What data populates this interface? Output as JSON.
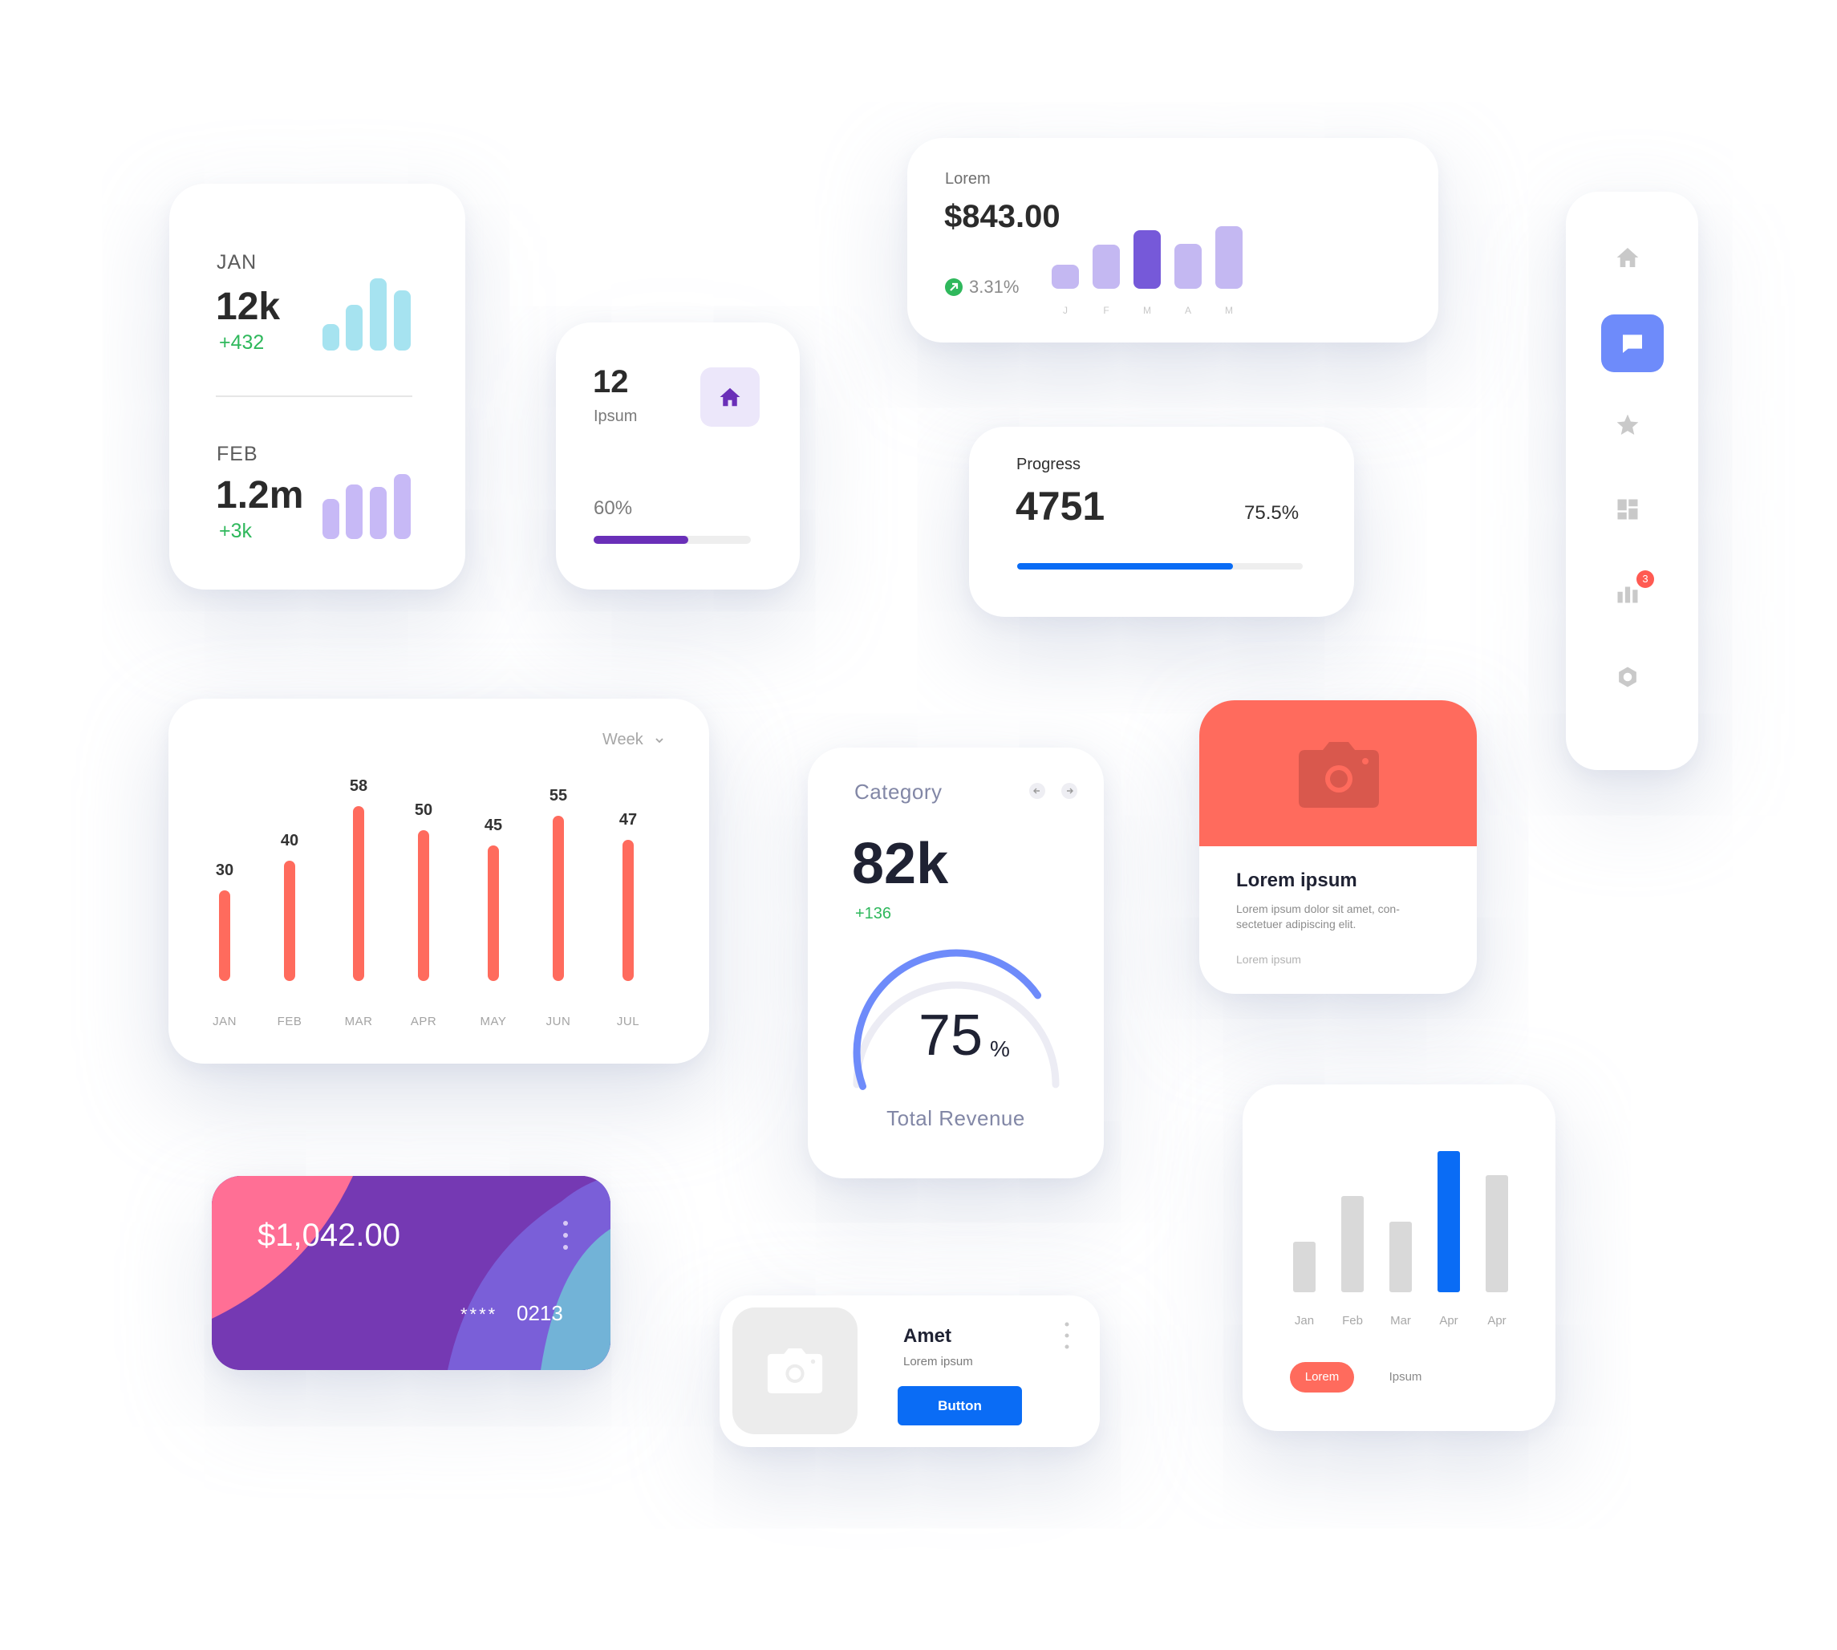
{
  "stats_card": {
    "jan": {
      "month": "JAN",
      "value": "12k",
      "delta": "+432"
    },
    "feb": {
      "month": "FEB",
      "value": "1.2m",
      "delta": "+3k"
    }
  },
  "ipsum_card": {
    "value": "12",
    "label": "Ipsum",
    "percent_label": "60%",
    "progress": 0.6
  },
  "lorem_card": {
    "label": "Lorem",
    "amount": "$843.00",
    "change": "3.31%",
    "months": [
      "J",
      "F",
      "M",
      "A",
      "M"
    ],
    "values": [
      0.38,
      0.7,
      0.93,
      0.72,
      1.0
    ],
    "highlight_index": 2
  },
  "progress_card": {
    "title": "Progress",
    "value": "4751",
    "percent_label": "75.5%",
    "progress": 0.755
  },
  "sidebar": {
    "badge": "3",
    "items": [
      {
        "icon": "home-icon",
        "active": false
      },
      {
        "icon": "chat-icon",
        "active": true
      },
      {
        "icon": "star-icon",
        "active": false
      },
      {
        "icon": "dashboard-icon",
        "active": false
      },
      {
        "icon": "chart-icon",
        "active": false
      },
      {
        "icon": "settings-icon",
        "active": false
      }
    ]
  },
  "week_chart": {
    "dropdown_label": "Week",
    "value_labels": [
      "30",
      "40",
      "58",
      "50",
      "45",
      "55",
      "47"
    ]
  },
  "category_card": {
    "title": "Category",
    "value": "82k",
    "delta": "+136",
    "gauge_value": "75",
    "gauge_unit": "%",
    "gauge_fraction": 0.75,
    "caption": "Total Revenue"
  },
  "image_card": {
    "title": "Lorem ipsum",
    "body_line1": "Lorem ipsum dolor sit amet, con-",
    "body_line2": "sectetuer adipiscing elit.",
    "footer": "Lorem ipsum"
  },
  "credit_card": {
    "amount": "$1,042.00",
    "masked": "****",
    "last4": "0213"
  },
  "amet_card": {
    "title": "Amet",
    "subtitle": "Lorem ipsum",
    "button_label": "Button"
  },
  "small_chart": {
    "legend_active": "Lorem",
    "legend_inactive": "Ipsum"
  },
  "chart_data": [
    {
      "type": "bar",
      "categories": [
        "JAN",
        "FEB",
        "MAR",
        "APR",
        "MAY",
        "JUN",
        "JUL"
      ],
      "values": [
        30,
        40,
        58,
        50,
        45,
        55,
        47
      ],
      "ylim": [
        0,
        60
      ]
    },
    {
      "type": "bar",
      "categories": [
        "Jan",
        "Feb",
        "Mar",
        "Apr",
        "Apr"
      ],
      "values": [
        0.36,
        0.68,
        0.5,
        1.0,
        0.83
      ],
      "highlight_index": 3
    }
  ],
  "colors": {
    "purple": "#6a2fb8",
    "blue": "#0a6cf5",
    "coral": "#ff6b5d",
    "green": "#2fb85c",
    "teal_bar": "#a6e3f0",
    "lilac_bar": "#c7b9f6",
    "violet": "#7659d9"
  }
}
